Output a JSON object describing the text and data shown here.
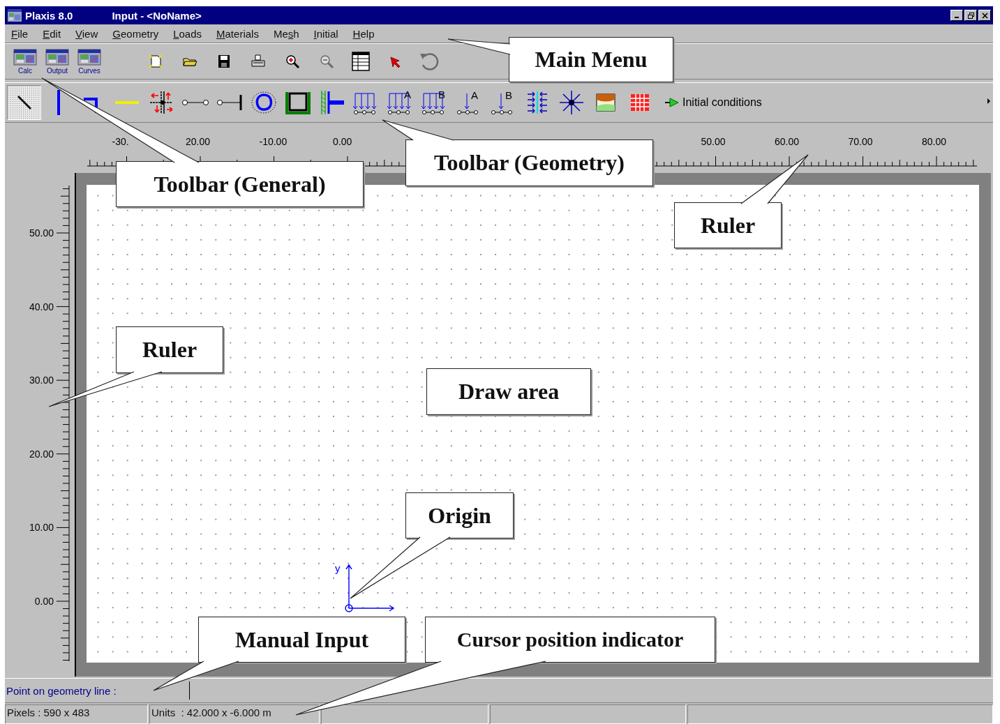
{
  "window": {
    "app_title": "Plaxis 8.0",
    "doc_title": "Input - <NoName>"
  },
  "menu": [
    {
      "key": "F",
      "post": "ile"
    },
    {
      "key": "E",
      "post": "dit"
    },
    {
      "key": "V",
      "post": "iew"
    },
    {
      "key": "G",
      "post": "eometry"
    },
    {
      "key": "L",
      "post": "oads"
    },
    {
      "key": "M",
      "post": "aterials"
    },
    {
      "pre": "Me",
      "key": "s",
      "post": "h"
    },
    {
      "key": "I",
      "post": "nitial"
    },
    {
      "key": "H",
      "post": "elp"
    }
  ],
  "general_toolbar": [
    {
      "kind": "program",
      "label": "Calc",
      "disabled": false
    },
    {
      "kind": "program",
      "label": "Output",
      "disabled": false
    },
    {
      "kind": "program",
      "label": "Curves",
      "disabled": false
    },
    {
      "kind": "new",
      "disabled": false
    },
    {
      "kind": "open",
      "disabled": false
    },
    {
      "kind": "save",
      "disabled": false
    },
    {
      "kind": "print",
      "disabled": false
    },
    {
      "kind": "zoom_in",
      "disabled": false
    },
    {
      "kind": "zoom_out",
      "disabled": true
    },
    {
      "kind": "table",
      "disabled": false
    },
    {
      "kind": "select",
      "disabled": false
    },
    {
      "kind": "undo",
      "disabled": true
    }
  ],
  "geometry_toolbar": [
    {
      "kind": "select",
      "pressed": true
    },
    {
      "kind": "line",
      "pressed": false
    },
    {
      "kind": "plate",
      "pressed": false
    },
    {
      "kind": "geogrid",
      "pressed": false
    },
    {
      "kind": "interface",
      "pressed": false
    },
    {
      "kind": "node_anchor",
      "pressed": false
    },
    {
      "kind": "fixed_anchor",
      "pressed": false
    },
    {
      "kind": "tunnel",
      "pressed": false
    },
    {
      "kind": "fixities",
      "pressed": false
    },
    {
      "kind": "hinge",
      "pressed": false
    },
    {
      "kind": "load",
      "pressed": false
    },
    {
      "kind": "load",
      "letter": "A",
      "pressed": false
    },
    {
      "kind": "load",
      "letter": "B",
      "pressed": false
    },
    {
      "kind": "point_load",
      "letter": "A",
      "pressed": false
    },
    {
      "kind": "point_load",
      "letter": "B",
      "pressed": false
    },
    {
      "kind": "drain",
      "pressed": false
    },
    {
      "kind": "well",
      "pressed": false
    },
    {
      "kind": "materials",
      "pressed": false
    },
    {
      "kind": "mesh",
      "pressed": false
    },
    {
      "kind": "initial",
      "label": "Initial conditions",
      "pressed": false
    }
  ],
  "horizontal_ruler": {
    "labels": [
      "-30.",
      "20.00",
      "-10.00",
      "0.00",
      "50.00",
      "60.00",
      "70.00",
      "80.00"
    ]
  },
  "vertical_ruler": {
    "labels": [
      "50.00",
      "40.00",
      "30.00",
      "20.00",
      "10.00",
      "0.00"
    ]
  },
  "origin_marker": {
    "axis_label": "y"
  },
  "manual_input": {
    "label": "Point on geometry line :"
  },
  "status_bar": {
    "cells": [
      "Pixels : 590 x 483",
      "Units  : 42.000 x -6.000 m"
    ]
  },
  "callouts": [
    {
      "text": "Main Menu"
    },
    {
      "text": "Toolbar (General)"
    },
    {
      "text": "Toolbar (Geometry)"
    },
    {
      "text": "Ruler"
    },
    {
      "text": "Ruler"
    },
    {
      "text": "Draw area"
    },
    {
      "text": "Origin"
    },
    {
      "text": "Manual Input"
    },
    {
      "text": "Cursor position indicator"
    }
  ]
}
